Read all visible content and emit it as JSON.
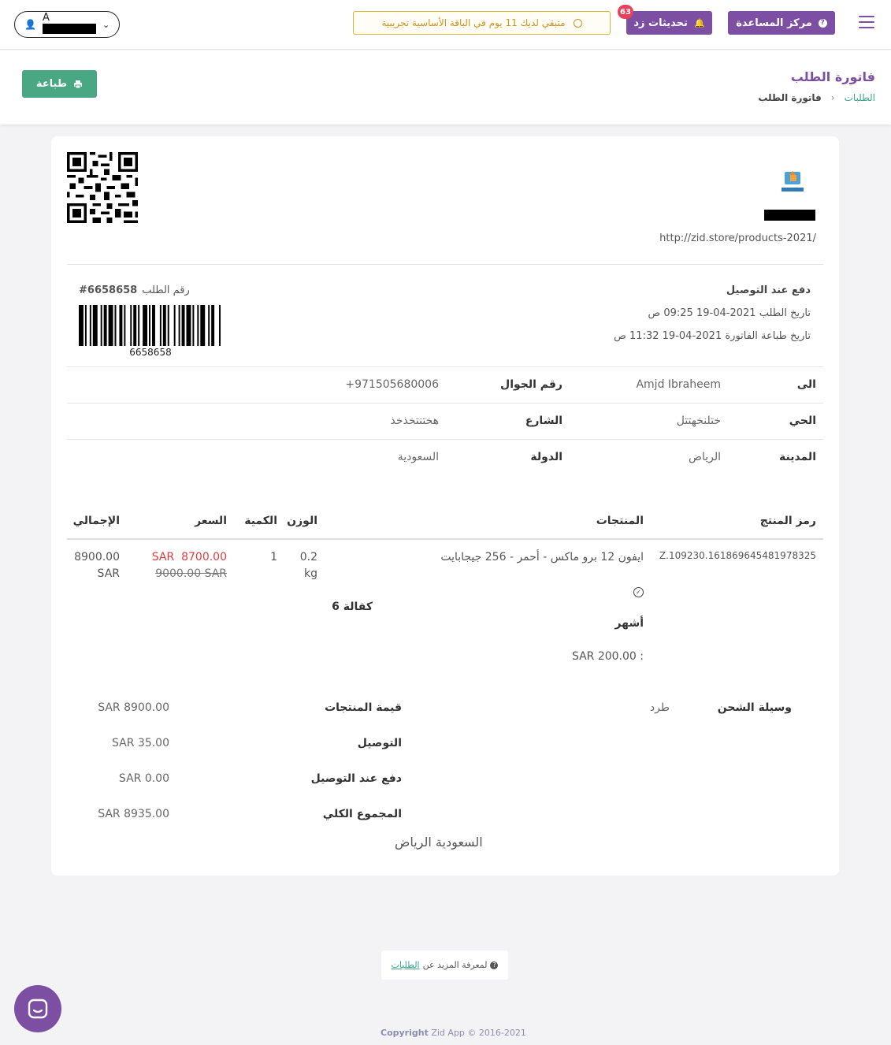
{
  "topbar": {
    "help_label": "مركز المساعدة",
    "updates_label": "تحديثات زد",
    "updates_badge": "63",
    "trial_text": "متبقي لديك 11 يوم في الباقة الأساسية تجريبية",
    "user_initial": "A"
  },
  "header": {
    "title": "فاتورة الطلب",
    "breadcrumb": [
      {
        "label": "الطلبات"
      },
      {
        "label": "فاتورة الطلب"
      }
    ],
    "print_label": "طباعة"
  },
  "invoice": {
    "store_url": "http://zid.store/products-2021/",
    "payment_method": "دفع عند التوصيل",
    "order_date": "تاريخ الطلب 2021-04-19 09:25 ص",
    "print_date": "تاريخ طباعة الفاتورة 2021-04-19 11:32 ص",
    "order_number_label": "رقم الطلب",
    "order_number": "#6658658",
    "barcode_number": "6658658",
    "to_label": "الى",
    "to_value": "Amjd Ibraheem",
    "mobile_label": "رقم الجوال",
    "mobile_value": "+971505680006",
    "district_label": "الحي",
    "district_value": "ختلنخهتتل",
    "street_label": "الشارع",
    "street_value": "هختنتخذخذ",
    "city_label": "المدينة",
    "city_value": "الرياض",
    "country_label": "الدولة",
    "country_value": "السعودية",
    "columns": {
      "sku": "رمز المنتج",
      "products": "المنتجات",
      "weight": "الوزن",
      "quantity": "الكمية",
      "price": "السعر",
      "total": "الإجمالي"
    },
    "item": {
      "sku": "Z.109230.1618696454819783​25",
      "name": "ايفون 12 برو ماكس - أحمر - 256 جيجابايت",
      "option_label": "أشهر",
      "option_value": "كفالة 6",
      "option_price": "SAR 200.00 :",
      "weight_value": "0.2",
      "weight_unit": "kg",
      "quantity": "1",
      "price_sale": "SAR  8700.00",
      "price_original": "9000.00 SAR",
      "total_amount": "8900.00",
      "total_currency": "SAR"
    },
    "shipping_label": "وسيلة الشحن",
    "shipping_value": "طرد",
    "totals": [
      {
        "label": "قيمة المنتجات",
        "value": "SAR 8900.00"
      },
      {
        "label": "التوصيل",
        "value": "SAR 35.00"
      },
      {
        "label": "دفع عند التوصيل",
        "value": "SAR 0.00"
      },
      {
        "label": "المجموع الكلي",
        "value": "SAR 8935.00"
      }
    ],
    "address_footer": "السعودية الرياض"
  },
  "footer": {
    "more_prefix": "لمعرفة المزيد عن",
    "more_link": "الطلبات",
    "copyright_brand": "Copyright",
    "copyright_rest": "Zid App © 2016-2021"
  },
  "colors": {
    "brand_purple": "#7d4fa3",
    "print_green": "#49a783",
    "sale_red": "#e23b3b",
    "trial_yellow": "#e0b33a"
  }
}
